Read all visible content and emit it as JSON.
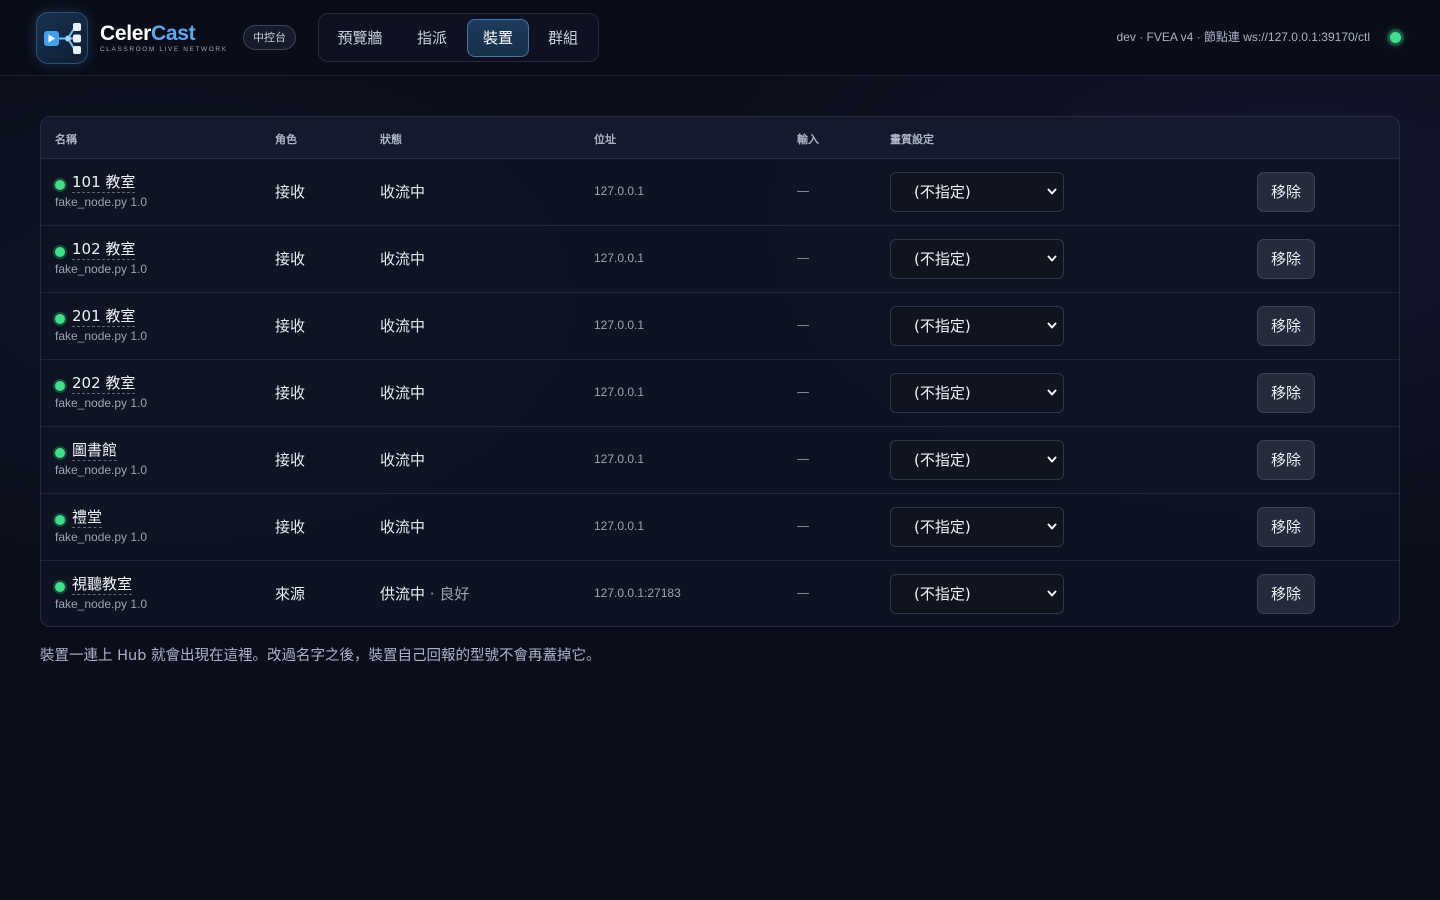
{
  "header": {
    "brand_prefix": "Celer",
    "brand_suffix": "Cast",
    "brand_subtitle": "CLASSROOM LIVE NETWORK",
    "console_badge": "中控台",
    "tabs": [
      {
        "label": "預覽牆",
        "active": false
      },
      {
        "label": "指派",
        "active": false
      },
      {
        "label": "裝置",
        "active": true
      },
      {
        "label": "群組",
        "active": false
      }
    ],
    "hub_info": "dev · FVEA v4 · 節點連 ws://127.0.0.1:39170/ctl",
    "hub_status_color": "#3fe08a"
  },
  "table": {
    "columns": {
      "name": "名稱",
      "role": "角色",
      "status": "狀態",
      "address": "位址",
      "input": "輸入",
      "quality": "畫質設定"
    },
    "rows": [
      {
        "name": "101 教室",
        "model": "fake_node.py 1.0",
        "role": "接收",
        "status": "收流中",
        "status_extra": "",
        "address": "127.0.0.1",
        "input": "—",
        "quality": "(不指定)",
        "remove": "移除"
      },
      {
        "name": "102 教室",
        "model": "fake_node.py 1.0",
        "role": "接收",
        "status": "收流中",
        "status_extra": "",
        "address": "127.0.0.1",
        "input": "—",
        "quality": "(不指定)",
        "remove": "移除"
      },
      {
        "name": "201 教室",
        "model": "fake_node.py 1.0",
        "role": "接收",
        "status": "收流中",
        "status_extra": "",
        "address": "127.0.0.1",
        "input": "—",
        "quality": "(不指定)",
        "remove": "移除"
      },
      {
        "name": "202 教室",
        "model": "fake_node.py 1.0",
        "role": "接收",
        "status": "收流中",
        "status_extra": "",
        "address": "127.0.0.1",
        "input": "—",
        "quality": "(不指定)",
        "remove": "移除"
      },
      {
        "name": "圖書館",
        "model": "fake_node.py 1.0",
        "role": "接收",
        "status": "收流中",
        "status_extra": "",
        "address": "127.0.0.1",
        "input": "—",
        "quality": "(不指定)",
        "remove": "移除"
      },
      {
        "name": "禮堂",
        "model": "fake_node.py 1.0",
        "role": "接收",
        "status": "收流中",
        "status_extra": "",
        "address": "127.0.0.1",
        "input": "—",
        "quality": "(不指定)",
        "remove": "移除"
      },
      {
        "name": "視聽教室",
        "model": "fake_node.py 1.0",
        "role": "來源",
        "status": "供流中",
        "status_extra": " · 良好",
        "address": "127.0.0.1:27183",
        "input": "—",
        "quality": "(不指定)",
        "remove": "移除"
      }
    ]
  },
  "footer_note": "裝置一連上 Hub 就會出現在這裡。改過名字之後，裝置自己回報的型號不會再蓋掉它。"
}
